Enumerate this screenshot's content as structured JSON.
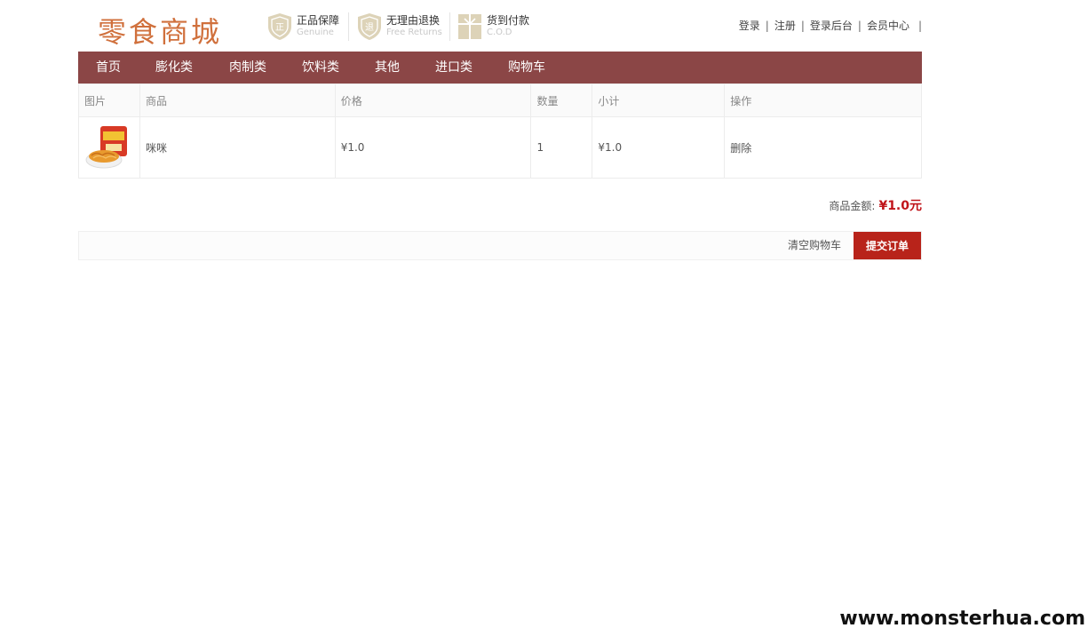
{
  "header": {
    "logo": "零食商城",
    "guarantees": [
      {
        "title": "正品保障",
        "sub": "Genuine",
        "icon": "genuine-shield-icon"
      },
      {
        "title": "无理由退换",
        "sub": "Free Returns",
        "icon": "returns-shield-icon"
      },
      {
        "title": "货到付款",
        "sub": "C.O.D",
        "icon": "cod-gift-icon"
      }
    ],
    "links": [
      "登录",
      "注册",
      "登录后台",
      "会员中心"
    ],
    "separator": "|"
  },
  "nav": {
    "items": [
      "首页",
      "膨化类",
      "肉制类",
      "饮料类",
      "其他",
      "进口类",
      "购物车"
    ]
  },
  "cart": {
    "headers": [
      "图片",
      "商品",
      "价格",
      "数量",
      "小计",
      "操作"
    ],
    "rows": [
      {
        "name": "咪咪",
        "price": "¥1.0",
        "qty": "1",
        "subtotal": "¥1.0",
        "action": "删除"
      }
    ]
  },
  "total": {
    "label": "商品金额:",
    "amount": "¥1.0元"
  },
  "actions": {
    "clear": "清空购物车",
    "submit": "提交订单"
  },
  "watermark": "www.monsterhua.com",
  "colors": {
    "nav_bg": "#8b4646",
    "submit_bg": "#b8231a",
    "total_color": "#c0141a",
    "logo_color": "#d0703c"
  }
}
